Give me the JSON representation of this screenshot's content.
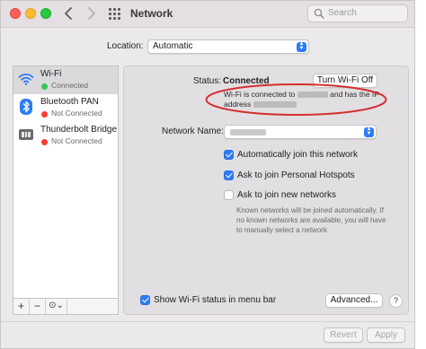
{
  "window": {
    "title": "Network",
    "search_placeholder": "Search"
  },
  "location": {
    "label": "Location:",
    "value": "Automatic"
  },
  "sidebar": {
    "items": [
      {
        "name": "Wi-Fi",
        "status": "Connected",
        "status_color": "#34c759",
        "icon": "wifi-icon",
        "selected": true
      },
      {
        "name": "Bluetooth PAN",
        "status": "Not Connected",
        "status_color": "#ff3b30",
        "icon": "bluetooth-icon",
        "selected": false
      },
      {
        "name": "Thunderbolt Bridge",
        "status": "Not Connected",
        "status_color": "#ff3b30",
        "icon": "thunderbolt-bridge-icon",
        "selected": false
      }
    ],
    "bar": {
      "add": "+",
      "remove": "−",
      "action": "⊙⌄"
    }
  },
  "detail": {
    "status_label": "Status:",
    "status_value": "Connected",
    "turn_off_button": "Turn Wi-Fi Off",
    "conn_text_1": "Wi-Fi is connected to",
    "conn_text_2": "and has the IP",
    "conn_text_3": "address",
    "network_name_label": "Network Name:",
    "checkboxes": [
      {
        "label": "Automatically join this network",
        "checked": true
      },
      {
        "label": "Ask to join Personal Hotspots",
        "checked": true
      },
      {
        "label": "Ask to join new networks",
        "checked": false
      }
    ],
    "hint": "Known networks will be joined automatically. If no known networks are available, you will have to manually select a network.",
    "show_status_label": "Show Wi-Fi status in menu bar",
    "show_status_checked": true,
    "advanced_button": "Advanced...",
    "help_button": "?"
  },
  "footer": {
    "revert_button": "Revert",
    "apply_button": "Apply"
  },
  "colors": {
    "accent": "#2d7bf6",
    "annotation": "#d32f2f"
  }
}
